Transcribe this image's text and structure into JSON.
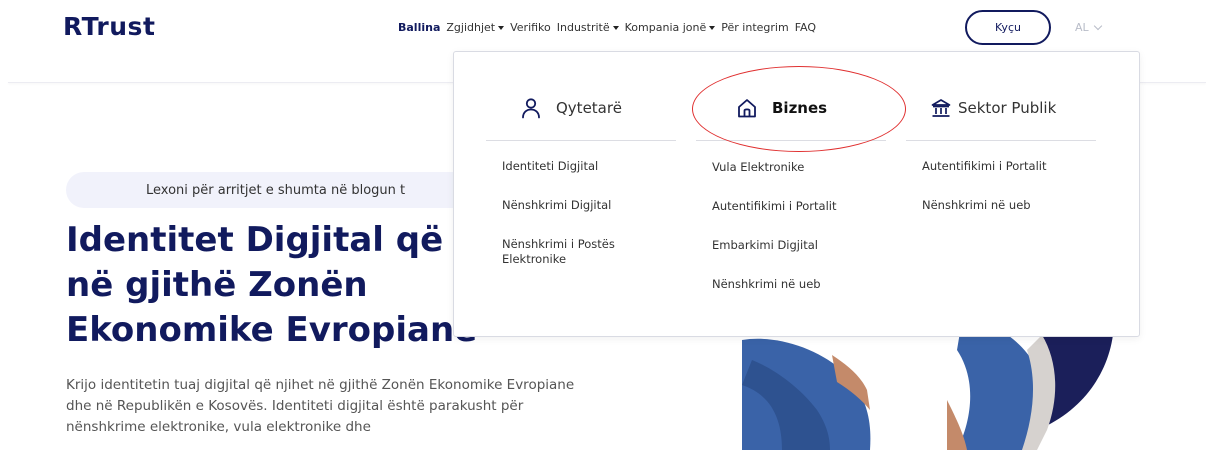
{
  "header": {
    "logo": "RTrust",
    "nav": [
      {
        "label": "Ballina",
        "active": true,
        "dropdown": false
      },
      {
        "label": "Zgjidhjet",
        "active": false,
        "dropdown": true
      },
      {
        "label": "Verifiko",
        "active": false,
        "dropdown": false
      },
      {
        "label": "Industritë",
        "active": false,
        "dropdown": true
      },
      {
        "label": "Kompania jonë",
        "active": false,
        "dropdown": true
      },
      {
        "label": "Për integrim",
        "active": false,
        "dropdown": false
      },
      {
        "label": "FAQ",
        "active": false,
        "dropdown": false
      }
    ],
    "login_label": "Kyçu",
    "language": "AL"
  },
  "dropdown": {
    "columns": [
      {
        "title": "Qytetarë",
        "icon": "person-icon",
        "links": [
          "Identiteti Digjital",
          "Nënshkrimi Digjital",
          "Nënshkrimi i Postës Elektronike"
        ]
      },
      {
        "title": "Biznes",
        "icon": "home-icon",
        "links": [
          "Vula Elektronike",
          "Autentifikimi i Portalit",
          "Embarkimi Digjital",
          "Nënshkrimi në ueb"
        ]
      },
      {
        "title": "Sektor Publik",
        "icon": "bank-icon",
        "links": [
          "Autentifikimi i Portalit",
          "Nënshkrimi në ueb"
        ]
      }
    ]
  },
  "hero": {
    "blog_text": "Lexoni për arritjet e shumta në blogun t",
    "title_lines": [
      "Identitet Digjital që",
      "në gjithë Zonën",
      "Ekonomike Evropiane"
    ],
    "description": "Krijo identitetin tuaj digjital që njihet në gjithë Zonën Ekonomike Evropiane dhe në Republikën e Kosovës. Identiteti digjital është parakusht për nënshkrime elektronike, vula elektronike dhe"
  },
  "colors": {
    "brand": "#111a5e",
    "highlight": "#e03030"
  }
}
